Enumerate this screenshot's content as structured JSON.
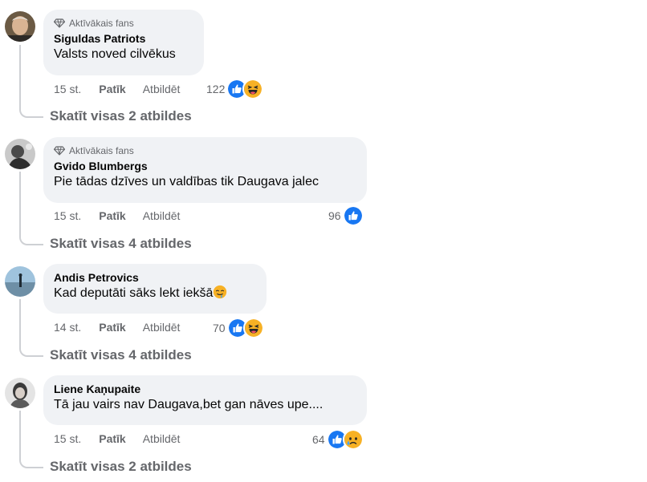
{
  "comments": [
    {
      "badge": "Aktīvākais fans",
      "author": "Siguldas Patriots",
      "text": "Valsts noved cilvēkus",
      "time": "15 st.",
      "like_label": "Patīk",
      "reply_label": "Atbildēt",
      "reaction_count": "122",
      "reactions": [
        "like",
        "haha"
      ],
      "view_replies": "Skatīt visas 2 atbildes"
    },
    {
      "badge": "Aktīvākais fans",
      "author": "Gvido Blumbergs",
      "text": "Pie tādas dzīves un valdības tik Daugava jalec",
      "time": "15 st.",
      "like_label": "Patīk",
      "reply_label": "Atbildēt",
      "reaction_count": "96",
      "reactions": [
        "like"
      ],
      "view_replies": "Skatīt visas 4 atbildes"
    },
    {
      "badge": "",
      "author": "Andis Petrovics",
      "text": "Kad deputāti sāks lekt iekšā",
      "text_emoji": "drooling-face",
      "time": "14 st.",
      "like_label": "Patīk",
      "reply_label": "Atbildēt",
      "reaction_count": "70",
      "reactions": [
        "like",
        "haha"
      ],
      "view_replies": "Skatīt visas 4 atbildes"
    },
    {
      "badge": "",
      "author": "Liene Kaņupaite",
      "text": "Tā jau vairs nav Daugava,bet gan nāves upe....",
      "time": "15 st.",
      "like_label": "Patīk",
      "reply_label": "Atbildēt",
      "reaction_count": "64",
      "reactions": [
        "like",
        "sad"
      ],
      "view_replies": "Skatīt visas 2 atbildes"
    }
  ],
  "colors": {
    "bubble": "#f0f2f5",
    "secondary_text": "#65676b",
    "like_blue": "#1877f2",
    "emoji_yellow": "#f7b125"
  }
}
